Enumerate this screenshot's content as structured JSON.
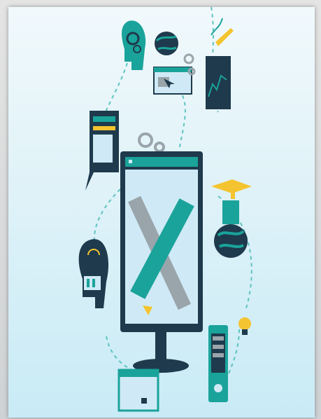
{
  "illustration": {
    "theme": "web-design-tools",
    "icons": [
      "monitor-icon",
      "pencil-ruler-icon",
      "head-gears-icon",
      "globe-icon",
      "browser-window-icon",
      "gear-icon",
      "chart-pen-icon",
      "code-card-icon",
      "idea-head-icon",
      "graduation-globe-icon",
      "lightbulb-icon",
      "phone-icon",
      "package-box-icon"
    ],
    "colors": {
      "teal": "#1aa39a",
      "dark_navy": "#1e3a4c",
      "yellow": "#f4c430",
      "light_blue": "#cfeaf6",
      "gray": "#9aa5ab"
    }
  }
}
